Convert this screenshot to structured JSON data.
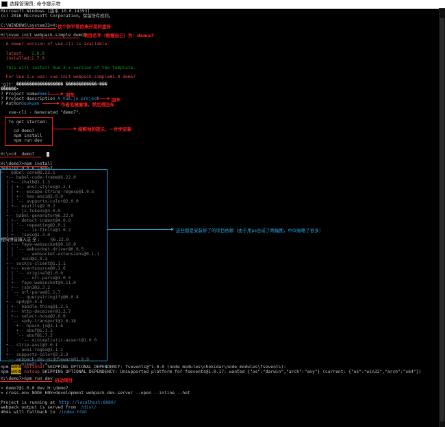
{
  "window": {
    "title": "选择管理员: 命令提示符"
  },
  "lines": {
    "l01": "Microsoft Windows [版本 10.0.14393]",
    "l02": "(c) 2016 Microsoft Corporation。保留所有权利。",
    "l03": "C:\\WINDOWS\\system32>H:",
    "l04": "H:\\>vue init webpack-simple demo7",
    "l05": "  A newer version of vue-cli is available.",
    "l06a": "  latest:",
    "l06b": "2.8.0",
    "l07a": "  installed:",
    "l07b": "2.7.0",
    "l08": "  This will install Vue 2.x version of the template.",
    "l09": "  For Vue 1.x use: vue init webpack-simple#1.0 demo7",
    "l10": "'git' ������������������ ������������•���",
    "l11": "������•",
    "l12a": "? Project name",
    "l12b": "demo7",
    "l13a": "? Project description",
    "l13b": "A Vue.js project",
    "l14a": "? Author",
    "l14b": "duokuan",
    "l15": "   vue-cli · Generated \"demo7\".",
    "l16": "   To get started:",
    "l17": "     cd demo7",
    "l18": "     npm install",
    "l19": "     npm run dev",
    "l20": "H:\\>cd  demo7",
    "l21": "H:\\demo7>npm install",
    "l22": "demo7@1.0.0 H:\\demo7",
    "l22b": "+-- babel-core@6.22.1",
    "l23": "  +-- babel-code-frame@6.22.0",
    "l24": "  | +-- chalk@1.1.3",
    "l25": "  | | +-- ansi-styles@2.2.1",
    "l26": "  | | +-- escape-string-regexp@1.0.5",
    "l27": "  | | +-- has-ansi@2.0.0",
    "l28": "  | | `-- supports-color@2.0.0",
    "l29": "  | +-- esutils@2.0.2",
    "l30": "  | `-- js-tokens@3.0.0",
    "l31": "  +-- babel-generator@6.22.0",
    "l32": "  | +-- detect-indent@4.0.0",
    "l33": "  | | `-- repeating@2.0.1",
    "l34": "  | |   `-- is-finite@1.0.2",
    "l35": "  | +-- jsesc@1.3.0",
    "l36a": "搜狗拼音输入法 全 :",
    "l36b": "@6.22.0",
    "l37": "  | +-- faye-websocket@0.10.0",
    "l38": "  | | `-- websocket-driver@0.6.5",
    "l39": "  | |   `-- websocket-extensions@0.1.1",
    "l40": "  | `-- uuid@2.0.3",
    "l41": "  +-- sockjs-client@1.1.1",
    "l42": "  | +-- eventsource@0.1.6",
    "l43": "  | | `-- original@1.0.0",
    "l44": "  | |   `-- url-parse@1.0.5",
    "l45": "  | +-- faye-websocket@0.11.0",
    "l46": "  | +-- json3@3.3.2",
    "l47": "  | `-- url-parse@1.1.7",
    "l48": "  |   `-- querystringify@0.0.4",
    "l49": "  +-- spdy@3.4.4",
    "l50": "  | +-- handle-thing@1.2.5",
    "l51": "  | +-- http-deceiver@1.2.7",
    "l52": "  | +-- select-hose@2.0.0",
    "l53": "  | `-- spdy-transport@2.0.18",
    "l54": "  |   +-- hpack.js@2.1.6",
    "l55": "  |   +-- obuf@1.1.1",
    "l56": "  |   `-- wbuf@1.7.2",
    "l57": "  |     `-- minimalistic-assert@1.0.0",
    "l58": "  +-- strip-ansi@3.0.1",
    "l59": "  | `-- ansi-regex@2.1.1",
    "l60": "  +-- supports-color@3.2.3",
    "l61": "  `-- webpack-dev-middleware@1.9.0",
    "l62": "    `-- mime@1.3.4",
    "l63a": "npm",
    "l63b": "WARN",
    "l63c": "optional",
    "l63d": " SKIPPING OPTIONAL DEPENDENCY: fsevents@^1.0.0 (node_modules\\chokidar\\node_modules\\fsevents):",
    "l64a": "npm",
    "l64b": "WARN",
    "l64c": "notsup",
    "l64d": " SKIPPING OPTIONAL DEPENDENCY: Unsupported platform for fsevents@1.0.17: wanted {\"os\":\"darwin\",\"arch\":\"any\"} (current: {\"os\":\"win32\",\"arch\":\"x64\"})",
    "l65": "H:\\demo7>npm run dev",
    "l66": "> demo7@1.0.0 dev H:\\demo7",
    "l67": "> cross-env NODE_ENV=development webpack-dev-server --open --inline --hot",
    "l68a": "Project is running at",
    "l68b": "http://localhost:8080/",
    "l69a": "webpack output is served from",
    "l69b": "/dist/",
    "l70a": "404s will fallback to",
    "l70b": "/index.html"
  },
  "annotations": {
    "a1": "找个你平常用来开发的盘符",
    "a2": "项目名字（根据自己）为：demo7",
    "a3": "回车",
    "a4": "回车",
    "a5": "作者名随意填，然后得回车",
    "a6": "按照他的提示，一步步安装",
    "a7": "这些都是安装好了的项目依赖（由于用ps合成了两幅图，中间省略了很多）",
    "a8": "启动项目"
  }
}
